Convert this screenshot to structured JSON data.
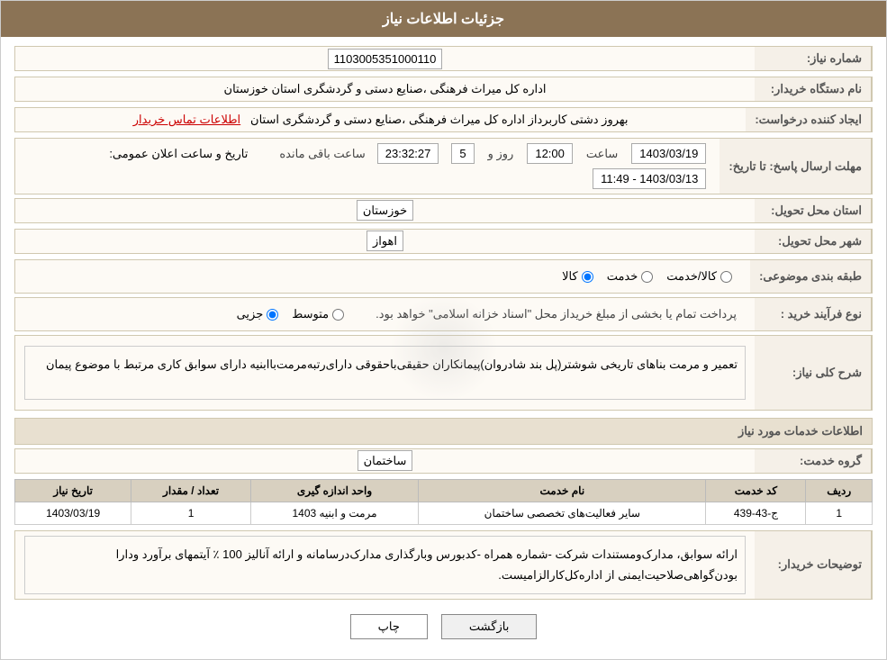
{
  "header": {
    "title": "جزئیات اطلاعات نیاز"
  },
  "fields": {
    "need_number_label": "شماره نیاز:",
    "need_number_value": "1103005351000110",
    "buyer_label": "نام دستگاه خریدار:",
    "buyer_value": "اداره کل میراث فرهنگی ،صنایع دستی و گردشگری استان خوزستان",
    "creator_label": "ایجاد کننده درخواست:",
    "creator_value": "بهروز دشتی کاربرداز اداره کل میراث فرهنگی ،صنایع دستی و گردشگری استان",
    "contact_link": "اطلاعات تماس خریدار",
    "announce_date_label": "تاریخ و ساعت اعلان عمومی:",
    "announce_date_value": "1403/03/13 - 11:49",
    "response_label": "مهلت ارسال پاسخ: تا تاریخ:",
    "response_date": "1403/03/19",
    "response_time_label": "ساعت",
    "response_time": "12:00",
    "response_day_label": "روز و",
    "response_day": "5",
    "response_remaining_label": "ساعت باقی مانده",
    "response_remaining": "23:32:27",
    "province_label": "استان محل تحویل:",
    "province_value": "خوزستان",
    "city_label": "شهر محل تحویل:",
    "city_value": "اهواز",
    "category_label": "طبقه بندی موضوعی:",
    "category_options": [
      "کالا",
      "خدمت",
      "کالا/خدمت"
    ],
    "category_selected": "کالا",
    "purchase_type_label": "نوع فرآیند خرید :",
    "purchase_options": [
      "جزیی",
      "متوسط"
    ],
    "purchase_note": "پرداخت تمام یا بخشی از مبلغ خریداز محل \"اسناد خزانه اسلامی\" خواهد بود.",
    "description_label": "شرح کلی نیاز:",
    "description_text": "تعمیر و مرمت بناهای تاریخی شوشتر(پل بند شادروان)پیمانکاران حقیقی‌باحقوقی دارای‌رتبه‌مرمت‌با‌ابنیه داراى سوابق کاری مرتبط با موضوع پیمان",
    "services_section": "اطلاعات خدمات مورد نیاز",
    "service_group_label": "گروه خدمت:",
    "service_group_value": "ساختمان",
    "table": {
      "headers": [
        "ردیف",
        "کد خدمت",
        "نام خدمت",
        "واحد اندازه گیری",
        "تعداد / مقدار",
        "تاریخ نیاز"
      ],
      "rows": [
        {
          "row": "1",
          "code": "ج-43-439",
          "name": "سایر فعالیت‌های تخصصی ساختمان",
          "unit": "مرمت و ابنیه 1403",
          "quantity": "1",
          "date": "1403/03/19"
        }
      ]
    },
    "buyer_notes_label": "توضیحات خریدار:",
    "buyer_notes_text": "ارائه سوابق، مدارک‌ومستندات شرکت -شماره همراه -کدبورس وبارگذاری مدارک‌درسامانه و ارائه آنالیز 100 ٪ آیتمهای برآورد ودارا بودن‌گواهی‌صلاحیت‌ایمنی از اداره‌کل‌کارالزامیست."
  },
  "buttons": {
    "print": "چاپ",
    "back": "بازگشت"
  }
}
